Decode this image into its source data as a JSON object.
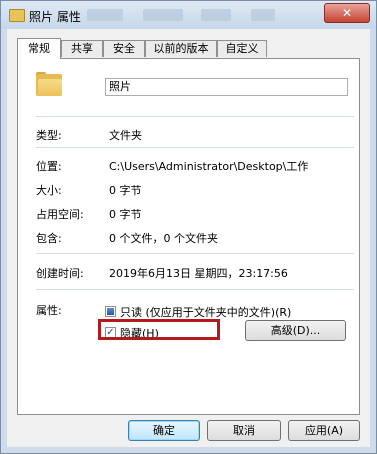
{
  "window": {
    "title": "照片 属性",
    "close_glyph": "✕"
  },
  "tabs": [
    {
      "label": "常规",
      "active": true
    },
    {
      "label": "共享",
      "active": false
    },
    {
      "label": "安全",
      "active": false
    },
    {
      "label": "以前的版本",
      "active": false
    },
    {
      "label": "自定义",
      "active": false
    }
  ],
  "general": {
    "name_value": "照片",
    "folder_icon": "folder-icon",
    "type_label": "类型:",
    "type_value": "文件夹",
    "location_label": "位置:",
    "location_value": "C:\\Users\\Administrator\\Desktop\\工作",
    "size_label": "大小:",
    "size_value": "0 字节",
    "disk_size_label": "占用空间:",
    "disk_size_value": "0 字节",
    "contains_label": "包含:",
    "contains_value": "0 个文件，0 个文件夹",
    "created_label": "创建时间:",
    "created_value": "2019年6月13日 星期四，23:17:56",
    "attributes_label": "属性:",
    "readonly_label": "只读 (仅应用于文件夹中的文件)(R)",
    "readonly_state": "indeterminate",
    "hidden_label": "隐藏(H)",
    "hidden_checked": true,
    "advanced_button": "高级(D)..."
  },
  "footer": {
    "ok": "确定",
    "cancel": "取消",
    "apply": "应用(A)"
  },
  "colors": {
    "highlight_border": "#b11b1b",
    "accent": "#3c7fb1"
  }
}
